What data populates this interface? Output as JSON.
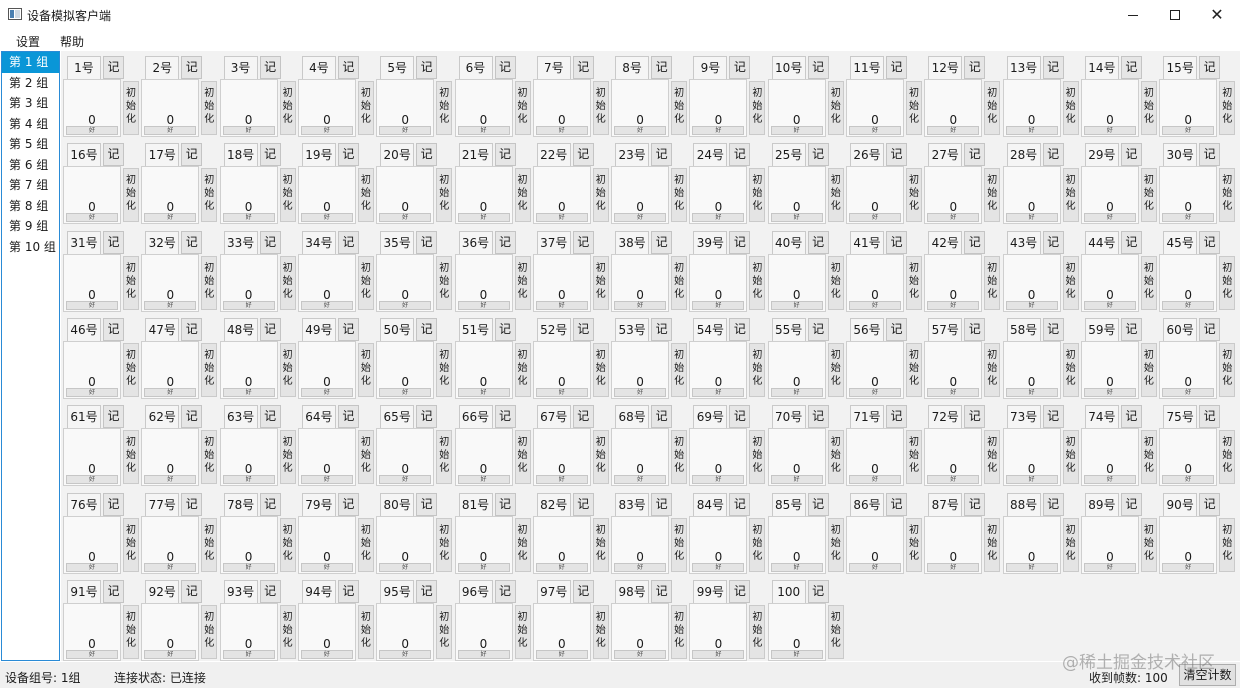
{
  "window": {
    "title": "设备模拟客户端",
    "minimize_icon": "minimize-icon",
    "maximize_icon": "maximize-icon",
    "close_icon": "close-icon",
    "close_glyph": "✕"
  },
  "menu": {
    "items": [
      "设置",
      "帮助"
    ]
  },
  "sidebar": {
    "groups": [
      "第 1 组",
      "第 2 组",
      "第 3 组",
      "第 4 组",
      "第 5 组",
      "第 6 组",
      "第 7 组",
      "第 8 组",
      "第 9 组",
      "第 10 组"
    ],
    "selected_index": 0,
    "selected_color": "#0a96d7"
  },
  "devices": {
    "count": 100,
    "columns": 15,
    "label_suffix": "号",
    "record_label": "记",
    "init_label": "初始化",
    "value": "0",
    "good_label": "好"
  },
  "status": {
    "group_label": "设备组号: 1组",
    "connection_label": "连接状态: 已连接",
    "frames_label": "收到帧数: 100",
    "clear_button": "清空计数"
  },
  "watermark": "@稀土掘金技术社区"
}
